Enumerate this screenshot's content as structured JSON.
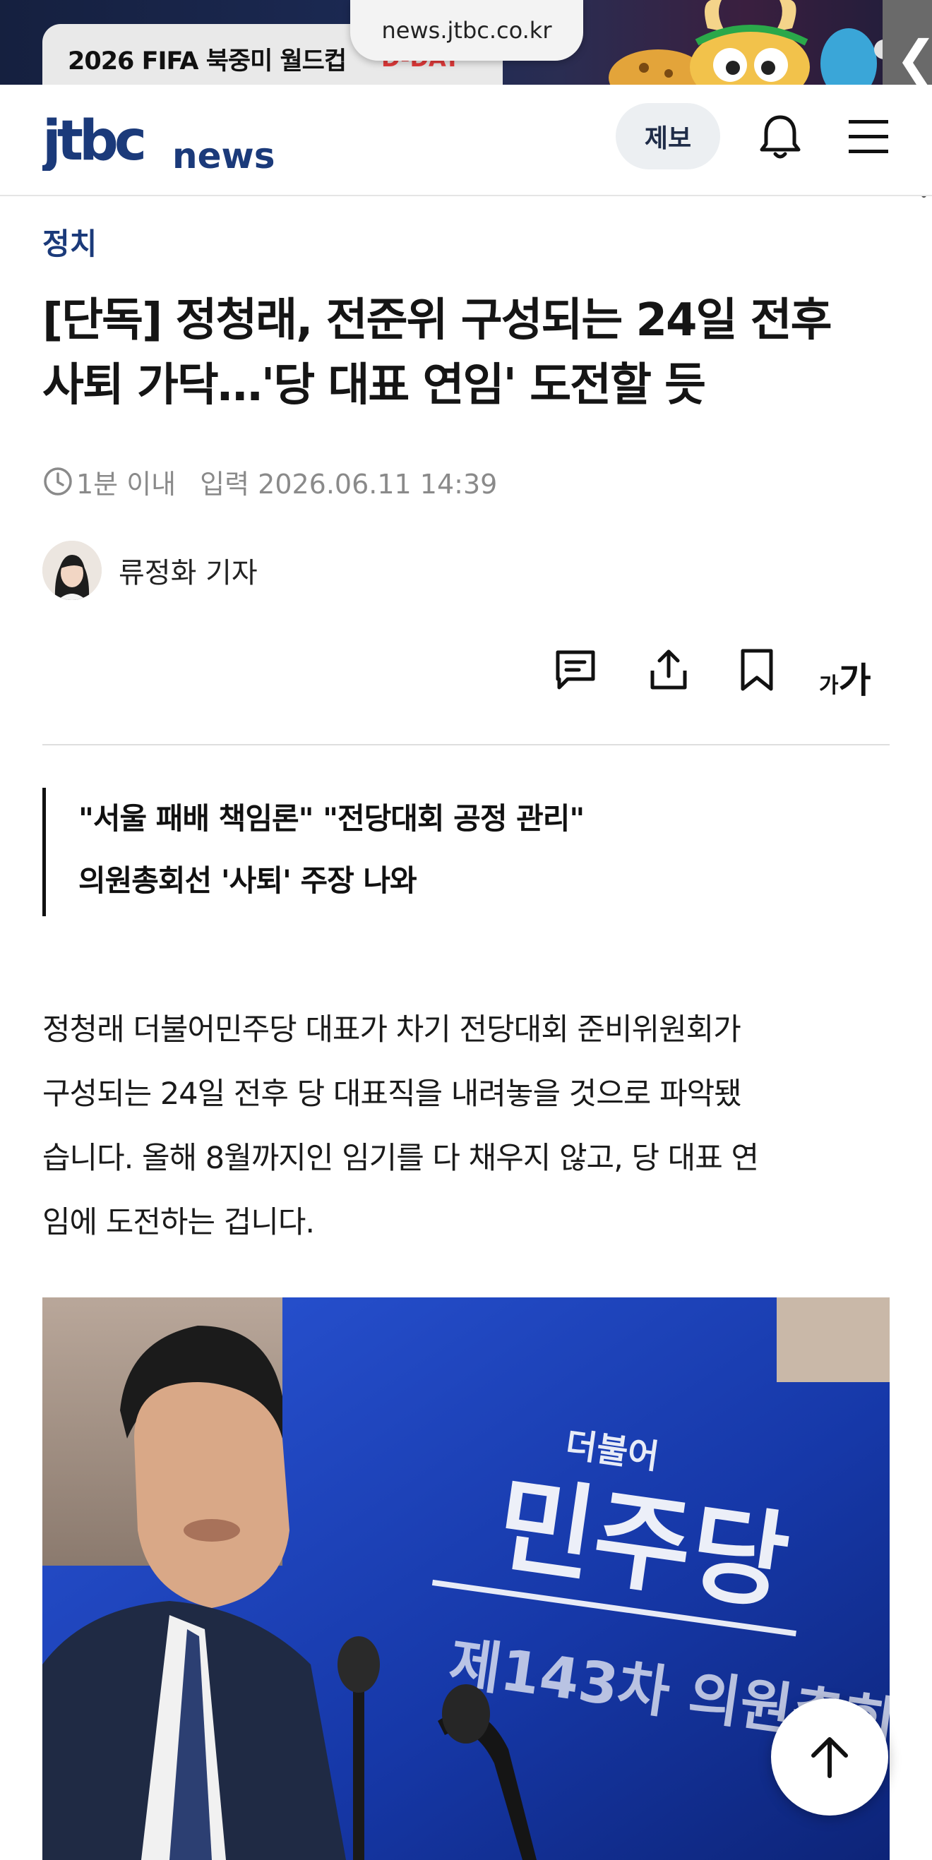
{
  "browser": {
    "url": "news.jtbc.co.kr"
  },
  "banner": {
    "text": "2026 FIFA 북중미 월드컵",
    "dday": "D-DAY"
  },
  "header": {
    "logo_brand": "jtbc",
    "logo_suffix": "news",
    "tip_button": "제보"
  },
  "article": {
    "category": "정치",
    "title_line1": "[단독] 정청래, 전준위 구성되는 24일 전후",
    "title_line2": "사퇴 가닥…'당 대표 연임' 도전할 듯",
    "read_time": "1분 이내",
    "input_date": "입력 2026.06.11 14:39",
    "reporter": "류정화 기자",
    "font_button_small": "가",
    "font_button_large": "가",
    "quote_line1": "\"서울 패배 책임론\" \"전당대회 공정 관리\"",
    "quote_line2": "의원총회선 '사퇴' 주장 나와",
    "body_line1": "정청래 더불어민주당 대표가 차기 전당대회 준비위원회가",
    "body_line2": "구성되는 24일 전후 당 대표직을 내려놓을 것으로 파악됐",
    "body_line3": "습니다. 올해 8월까지인 임기를 다 채우지 않고, 당 대표 연",
    "body_line4": "임에 도전하는 겁니다.",
    "photo_sign_line1": "더불어",
    "photo_sign_line2": "민주당",
    "photo_sign_line3": "제143차 의원총회"
  },
  "icons": {
    "clock": "clock-icon",
    "comment": "comment-icon",
    "share": "share-icon",
    "bookmark": "bookmark-icon",
    "bell": "bell-icon",
    "menu": "menu-icon",
    "back": "chevron-left-icon",
    "top": "arrow-up-icon"
  },
  "colors": {
    "brand_navy": "#1b3a7a",
    "photo_blue": "#1a3fb0",
    "dday_red": "#e23a3a"
  }
}
